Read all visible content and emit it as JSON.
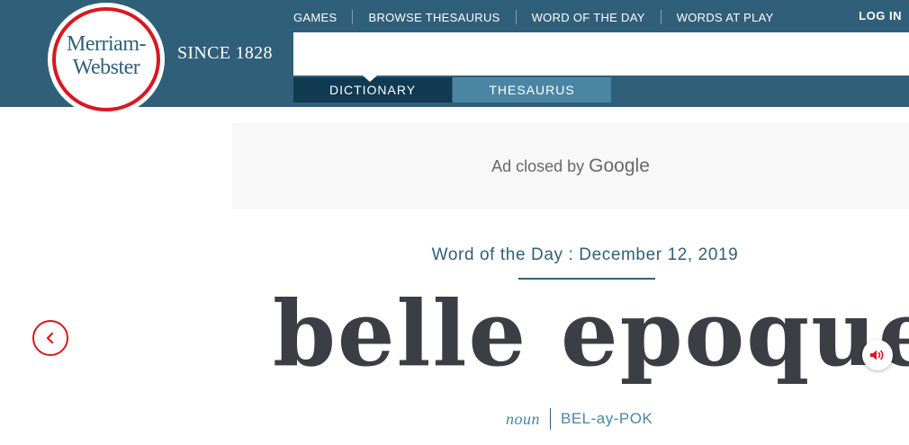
{
  "header": {
    "logo": {
      "line1": "Merriam-",
      "line2": "Webster"
    },
    "since": "SINCE 1828",
    "nav": [
      "GAMES",
      "BROWSE THESAURUS",
      "WORD OF THE DAY",
      "WORDS AT PLAY"
    ],
    "login": "LOG IN",
    "search": {
      "value": "",
      "placeholder": ""
    },
    "tabs": {
      "dictionary": "DICTIONARY",
      "thesaurus": "THESAURUS",
      "active": "dictionary"
    }
  },
  "ad": {
    "text": "Ad closed by",
    "brand": "Google"
  },
  "word_of_day": {
    "label": "Word of the Day : December 12, 2019",
    "word": "belle epoque",
    "part_of_speech": "noun",
    "pronunciation": "BEL-ay-POK"
  },
  "colors": {
    "brand_blue": "#305f7a",
    "accent_red": "#d71920",
    "tab_active": "#0f3a52",
    "tab_inactive": "#4a86a4"
  },
  "icons": {
    "prev": "chevron-left-icon",
    "audio": "speaker-icon"
  }
}
